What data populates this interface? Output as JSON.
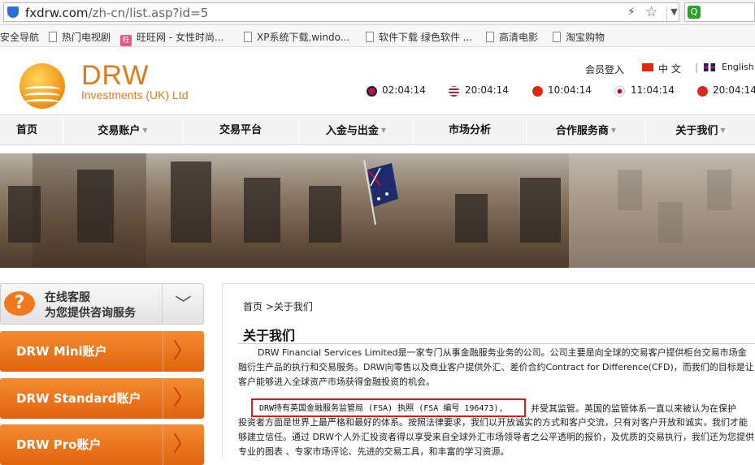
{
  "browser": {
    "url_domain": "fxdrw.com",
    "url_path": "/zh-cn/list.asp?id=5",
    "search_icon": "Q"
  },
  "bookmarks": [
    "安全导航",
    "热门电视剧",
    "旺旺网 - 女性时尚...",
    "XP系统下载,windo...",
    "软件下载 绿色软件 ...",
    "高清电影",
    "淘宝购物"
  ],
  "header": {
    "logo_brand": "DRW",
    "logo_sub": "Investments (UK) Ltd",
    "login": "会员登入",
    "lang_cn": "中 文",
    "lang_en": "English",
    "separator": "|",
    "clocks": [
      "02:04:14",
      "20:04:14",
      "10:04:14",
      "11:04:14",
      "20:04:14"
    ]
  },
  "nav": [
    "首页",
    "交易账户",
    "交易平台",
    "入金与出金",
    "市场分析",
    "合作服务商",
    "关于我们"
  ],
  "sidebar": {
    "service_line1": "在线客服",
    "service_line2": "为您提供咨询服务",
    "accounts": [
      "DRW Mini账户",
      "DRW Standard账户",
      "DRW Pro账户"
    ]
  },
  "content": {
    "breadcrumb": "首页 >关于我们",
    "title": "关于我们",
    "para1": "DRW Financial Services Limited是一家专门从事金融服务业务的公司。公司主要是向全球的交易客户提供柜台交易市场金融衍生产品的执行和交易服务。DRW向零售以及商业客户提供外汇、差价合约Contract for Difference(CFD)，而我们的目标是让客户能够进入全球资产市场获得金融投资的机会。",
    "highlight": "DRW持有英国金融服务监管局 (FSA) 执照 (FSA 编号 196473),",
    "after_highlight": "并受其监管。英国的监管体系一直以来被认为在保护",
    "para2": "投资者方面是世界上最严格和最好的体系。按照法律要求，我们以开放诚实的方式和客户交流，只有对客户开放和诚实，我们才能够建立信任。通过 DRW个人外汇投资者得以享受来自全球外汇市场领导者之公平透明的报价，及优质的交易执行，我们还为您提供专业的图表 、专家市场评论、先进的交易工具，和丰富的学习资源。"
  }
}
